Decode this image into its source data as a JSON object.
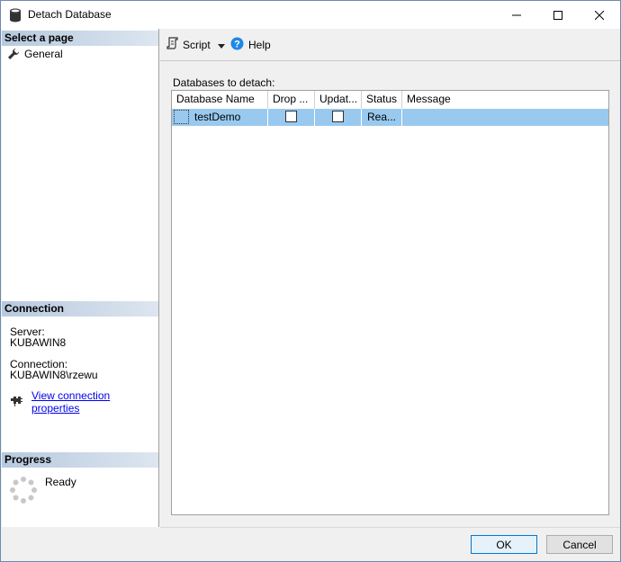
{
  "window": {
    "title": "Detach Database"
  },
  "left": {
    "select_page_header": "Select a page",
    "pages": [
      {
        "label": "General"
      }
    ],
    "connection_header": "Connection",
    "server_label": "Server:",
    "server_value": "KUBAWIN8",
    "connection_label": "Connection:",
    "connection_value": "KUBAWIN8\\rzewu",
    "view_connection_link": "View connection properties",
    "progress_header": "Progress",
    "progress_status": "Ready"
  },
  "toolbar": {
    "script_label": "Script",
    "help_label": "Help"
  },
  "main": {
    "databases_label": "Databases to detach:",
    "columns": [
      "Database Name",
      "Drop ...",
      "Updat...",
      "Status",
      "Message"
    ],
    "rows": [
      {
        "name": "testDemo",
        "drop_connections": false,
        "update_statistics": false,
        "status": "Rea...",
        "message": ""
      }
    ]
  },
  "buttons": {
    "ok": "OK",
    "cancel": "Cancel"
  },
  "colors": {
    "selection": "#99c9ef",
    "header_gradient_start": "#b7c9de",
    "link": "#0000ee"
  },
  "icons": [
    "database-icon",
    "wrench-icon",
    "script-icon",
    "help-icon",
    "connection-icon",
    "progress-spinner-icon"
  ]
}
